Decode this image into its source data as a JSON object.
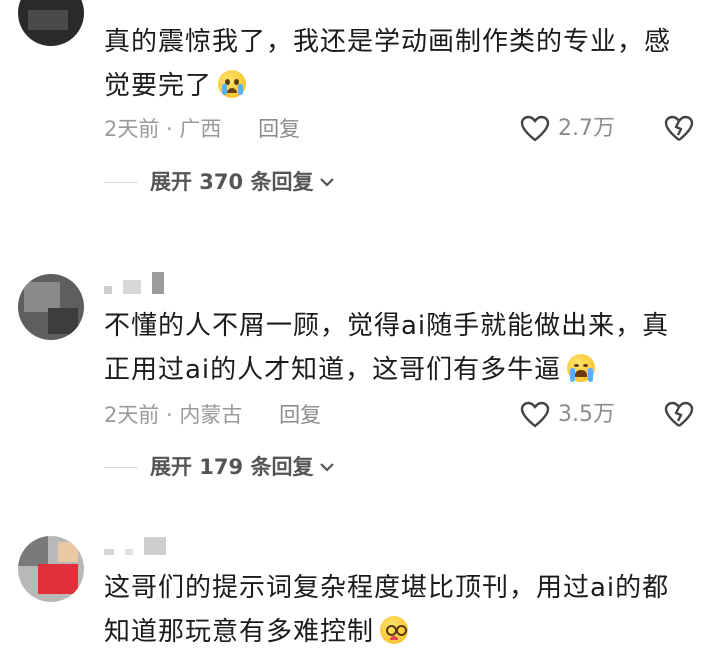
{
  "comments": [
    {
      "text_line1": "真的震惊我了，我还是学动画制作类的专业，感",
      "text_line2": "觉要完了",
      "emoji": "crying-face-emoji",
      "time_location": "2天前 · 广西",
      "reply_label": "回复",
      "likes": "2.7万",
      "expand_label": "展开 370 条回复"
    },
    {
      "text_line1": "不懂的人不屑一顾，觉得ai随手就能做出来，真",
      "text_line2": "正用过ai的人才知道，这哥们有多牛逼",
      "emoji": "loudly-crying-face-emoji",
      "time_location": "2天前 · 内蒙古",
      "reply_label": "回复",
      "likes": "3.5万",
      "expand_label": "展开 179 条回复"
    },
    {
      "text_line1": "这哥们的提示词复杂程度堪比顶刊，用过ai的都",
      "text_line2": "知道那玩意有多难控制",
      "emoji": "dizzy-face-emoji"
    }
  ],
  "colors": {
    "text": "#1b1b1b",
    "meta": "#9a9a9a",
    "accent_gray": "#8c8c8c"
  }
}
